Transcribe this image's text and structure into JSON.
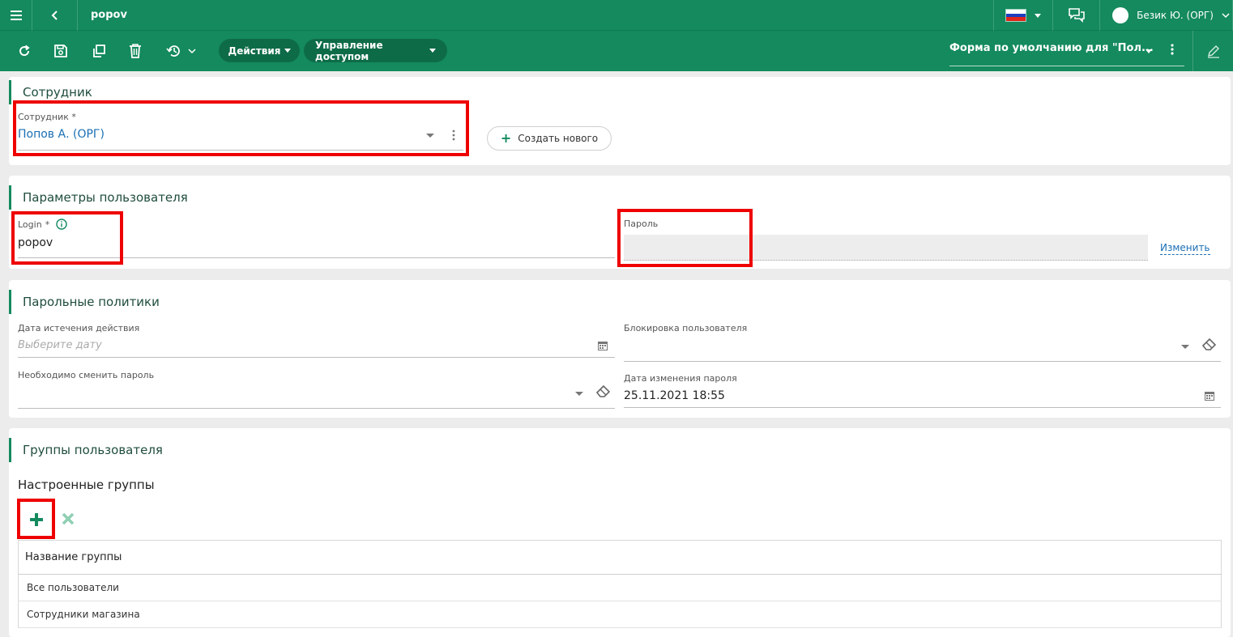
{
  "topbar": {
    "title": "popov",
    "user": "Безик Ю. (ОРГ)",
    "menu_icon": "hamburger-icon",
    "back_icon": "chevron-left-icon",
    "chat_icon": "chat-icon",
    "flag_colors": [
      "#ffffff",
      "#1c3fbf",
      "#e0261c"
    ]
  },
  "toolbar": {
    "actions_label": "Действия",
    "access_label": "Управление доступом",
    "form_select_value": "Форма по умолчанию для \"Пол...",
    "icons": [
      "refresh-icon",
      "save-icon",
      "copy-icon",
      "delete-icon",
      "history-icon",
      "more-vert-icon",
      "edit-icon"
    ]
  },
  "employee_section": {
    "title": "Сотрудник",
    "field_label": "Сотрудник",
    "required_mark": "*",
    "field_value": "Попов А. (ОРГ)",
    "create_button": "Создать нового"
  },
  "user_params": {
    "title": "Параметры пользователя",
    "login_label": "Login",
    "required_mark": "*",
    "login_value": "popov",
    "password_label": "Пароль",
    "change_link": "Изменить"
  },
  "password_policies": {
    "title": "Парольные политики",
    "expiry_label": "Дата истечения действия",
    "expiry_placeholder": "Выберите дату",
    "block_label": "Блокировка пользователя",
    "must_change_label": "Необходимо сменить пароль",
    "change_date_label": "Дата изменения пароля",
    "change_date_value": "25.11.2021 18:55"
  },
  "user_groups": {
    "title": "Группы пользователя",
    "subtitle": "Настроенные группы",
    "column_header": "Название группы",
    "rows": [
      "Все пользователи",
      "Сотрудники магазина"
    ]
  },
  "colors": {
    "brand": "#148a5e",
    "highlight": "#e00000",
    "link": "#1a6fb5"
  }
}
